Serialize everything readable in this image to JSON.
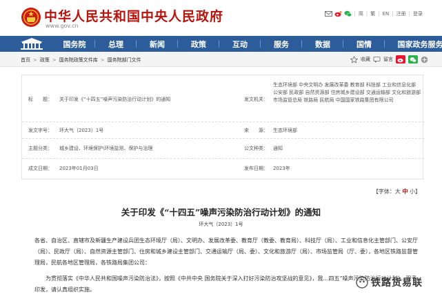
{
  "header": {
    "site_title": "中华人民共和国中央人民政府",
    "site_url": "www.gov.cn",
    "top_links": [
      "简",
      "繁",
      "EN",
      "注册",
      "登录"
    ]
  },
  "nav": {
    "items": [
      "国务院",
      "总理",
      "新闻",
      "政策",
      "互动",
      "服务",
      "数据",
      "国情",
      "国家政务服务平台"
    ]
  },
  "breadcrumb": {
    "items": [
      "首页",
      "政策",
      "国务院政策文件库",
      "国务院部门文件"
    ],
    "tools": [
      "收藏",
      "留言"
    ]
  },
  "info": {
    "title_label": "标　　题：",
    "title_value": "关于印发《“十四五”噪声污染防治行动计划》的通知",
    "issuer_label": "发文机关：",
    "issuer_value": "生态环境部 中央文明办 发展改革委 教育部 科技部 工业和信息化部 公安部 民政部 自然资源部 住房城乡建设部 交通运输部 文化和旅游部 市场监管总局 铁路局 民航局 中国国家铁路集团有限公司",
    "docno_label": "发文字号：",
    "docno_value": "环大气〔2023〕1号",
    "source_label": "来　　源：",
    "source_value": "生态环境部",
    "topic_label": "主题分类：",
    "topic_value": "城乡建设、环境保护\\环境监测、保护与治理",
    "type_label": "公文种类：",
    "type_value": "通知",
    "date_label": "成文日期：",
    "date_value": "2023年01月03日",
    "pub_label": "发布日期：",
    "pub_value": "2023年"
  },
  "fontsize": {
    "label": "【字体：",
    "big": "大",
    "mid": "中",
    "small": "小",
    "end": "】"
  },
  "article": {
    "title": "关于印发《“十四五”噪声污染防治行动计划》的通知",
    "docno": "环大气〔2023〕1号",
    "para1": "各省、自治区、直辖市及新疆生产建设兵团生态环境厅（局）、文明办、发展改革委、教育厅（教委、教育局）、科技厅（局）、工业和信息化主管部门、公安厅（局）、民政厅（局）、自然资源主管部门、住房和城乡建设主管部门、交通运输厅（局、委）、文化和旅游厅（局）、市场监管局（厅、委），各地区铁路监督管理局，民航各地区管理局，各铁路局集团公司：",
    "para2": "为贯彻落实《中华人民共和国噪声污染防治法》，按照《中共中央 国务院关于深入打好污染防治攻坚战的意见》，我…四五”噪声污染防治行动计划》。现予印发，请认真组织实施。"
  },
  "watermark": {
    "text": "铁路货易联"
  },
  "colors": {
    "brand_red": "#b8130c",
    "nav_blue": "#2c5d9a",
    "accent_red": "#cc0000"
  }
}
